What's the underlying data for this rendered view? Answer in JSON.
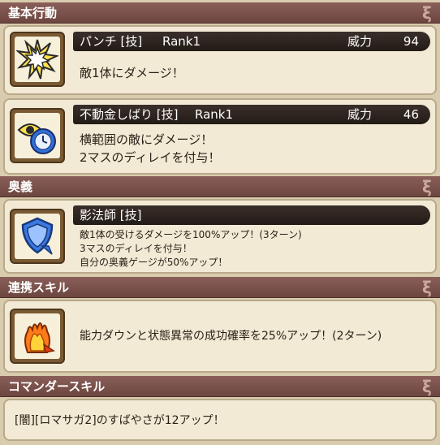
{
  "sections": {
    "basic": {
      "title": "基本行動"
    },
    "ougi": {
      "title": "奥義"
    },
    "renkei": {
      "title": "連携スキル"
    },
    "commander": {
      "title": "コマンダースキル"
    }
  },
  "skills": [
    {
      "name": "パンチ [技]",
      "rank": "Rank1",
      "power_label": "威力",
      "power_value": "94",
      "icon": "burst-star-icon",
      "description": [
        "敵1体にダメージ！"
      ]
    },
    {
      "name": "不動金しばり [技]",
      "rank": "Rank1",
      "power_label": "威力",
      "power_value": "46",
      "icon": "eye-clock-icon",
      "description": [
        "横範囲の敵にダメージ！",
        "2マスのディレイを付与！"
      ]
    }
  ],
  "ougi": {
    "name": "影法師 [技]",
    "icon": "shield-arrow-icon",
    "description": [
      "敵1体の受けるダメージを100%アップ！(3ターン)",
      "3マスのディレイを付与！",
      "自分の奥義ゲージが50%アップ！"
    ]
  },
  "renkei": {
    "icon": "fire-hand-icon",
    "description": "能力ダウンと状態異常の成功確率を25%アップ！(2ターン)"
  },
  "commander": {
    "description": "[闇][ロマサガ2]のすばやさが12アップ！"
  },
  "colors": {
    "header_bg": "#7a524c",
    "card_bg": "#f2ead5",
    "skill_bar_bg": "#2c231f",
    "page_bg": "#d9ccae"
  }
}
